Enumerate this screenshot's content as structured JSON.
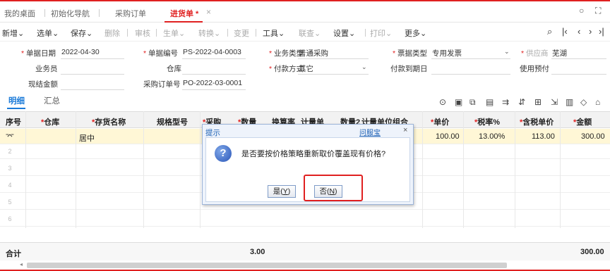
{
  "tabs": [
    {
      "label": "我的桌面"
    },
    {
      "label": "初始化导航"
    },
    {
      "label": "采购订单"
    },
    {
      "label": "进货单 *"
    }
  ],
  "toolbar": {
    "new": "新增",
    "select_doc": "选单",
    "save": "保存",
    "delete": "删除",
    "audit": "审核",
    "gen_doc": "生单",
    "convert": "转换",
    "change": "变更",
    "tools": "工具",
    "linked": "联查",
    "settings": "设置",
    "print": "打印",
    "more": "更多"
  },
  "form": {
    "doc_date_label": "单据日期",
    "doc_date": "2022-04-30",
    "doc_no_label": "单据编号",
    "doc_no": "PS-2022-04-0003",
    "biz_type_label": "业务类型",
    "biz_type": "普通采购",
    "invoice_type_label": "票据类型",
    "invoice_type": "专用发票",
    "supplier_label": "供应商",
    "supplier": "芜湖",
    "clerk_label": "业务员",
    "warehouse_label": "仓库",
    "pay_method_label": "付款方式",
    "pay_method": "其它",
    "pay_due_label": "付款到期日",
    "use_prepay_label": "使用预付",
    "cash_amount_label": "现结金额",
    "po_no_label": "采购订单号",
    "po_no": "PO-2022-03-0001"
  },
  "subtabs": {
    "detail": "明细",
    "summary": "汇总"
  },
  "grid": {
    "headers": {
      "seq": "序号",
      "warehouse": "仓库",
      "item_name": "存货名称",
      "spec": "规格型号",
      "purchase": "采购",
      "qty": "数量",
      "conv_rate": "换算率",
      "unit": "计量单",
      "qty2": "数量2",
      "unit_group": "计量单位组合",
      "price": "单价",
      "tax_rate": "税率%",
      "tax_price": "含税单价",
      "amount": "金额"
    },
    "rows": [
      {
        "num": "1",
        "item_name": "居中",
        "price": "100.00",
        "tax_rate": "13.00%",
        "tax_price": "113.00",
        "amount": "300.00"
      },
      {
        "num": "2"
      },
      {
        "num": "3"
      },
      {
        "num": "4"
      },
      {
        "num": "5"
      },
      {
        "num": "6"
      }
    ],
    "total_label": "合计",
    "total_qty": "3.00",
    "total_amount": "300.00"
  },
  "dialog": {
    "title": "提示",
    "help": "问服宝",
    "message": "是否要按价格策略重新取价覆盖现有价格?",
    "yes_label": "是",
    "yes_key": "Y",
    "no_label": "否",
    "no_key": "N"
  },
  "colors": {
    "accent": "#e02020",
    "link": "#1a7ad8",
    "selected_row": "#fff7d6"
  }
}
